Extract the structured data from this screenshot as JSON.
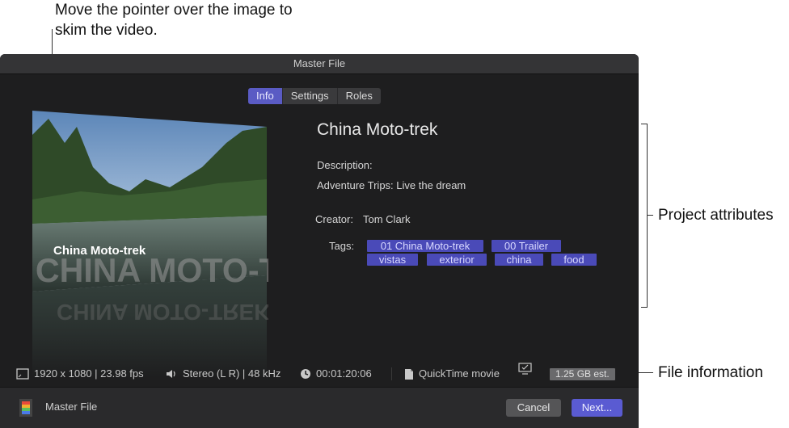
{
  "callouts": {
    "top": "Move the pointer over the image to skim the video.",
    "project": "Project attributes",
    "file": "File information"
  },
  "window": {
    "title": "Master File",
    "tabs": [
      {
        "label": "Info",
        "active": true
      },
      {
        "label": "Settings",
        "active": false
      },
      {
        "label": "Roles",
        "active": false
      }
    ]
  },
  "preview": {
    "overlay_text": "China Moto-trek",
    "reflect_text": "CHINA MOTO-TREK"
  },
  "attributes": {
    "title": "China Moto-trek",
    "description_label": "Description:",
    "description_value": "Adventure Trips: Live the dream",
    "creator_label": "Creator:",
    "creator_value": "Tom Clark",
    "tags_label": "Tags:",
    "tags": [
      "01 China Moto-trek",
      "00 Trailer",
      "vistas",
      "exterior",
      "china",
      "food"
    ]
  },
  "file_info": {
    "resolution": "1920 x 1080 | 23.98 fps",
    "audio": "Stereo (L R) | 48 kHz",
    "duration": "00:01:20:06",
    "format": "QuickTime movie",
    "size": "1.25 GB est."
  },
  "footer": {
    "label": "Master File",
    "cancel": "Cancel",
    "next": "Next..."
  },
  "colors": {
    "accent": "#5a5bd2",
    "tag_bg": "#4a4ab8",
    "window_bg": "#1e1e1f"
  }
}
